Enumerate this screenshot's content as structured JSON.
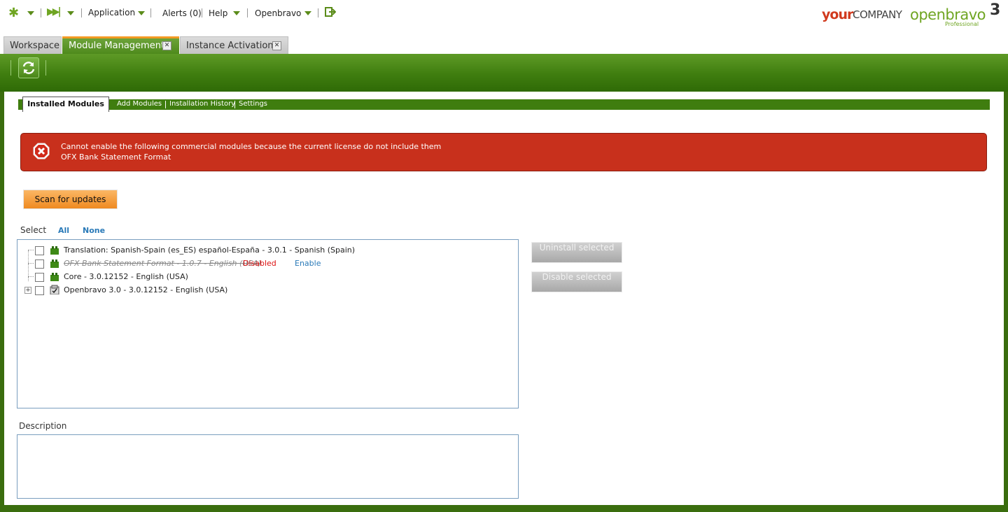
{
  "topnav": {
    "application": "Application",
    "alerts": "Alerts (0)",
    "help": "Help",
    "user": "Openbravo"
  },
  "brand": {
    "your": "your",
    "company": "COMPANY",
    "openbravo": "openbravo",
    "edition": "Professional",
    "version": "3"
  },
  "tabs": [
    {
      "label": "Workspace",
      "active": false
    },
    {
      "label": "Module Management",
      "active": true
    },
    {
      "label": "Instance Activation",
      "active": false
    }
  ],
  "subtabs": {
    "active": "Installed Modules",
    "links": [
      "Add Modules",
      "Installation History",
      "Settings"
    ]
  },
  "error": {
    "line1": "Cannot enable the following commercial modules because the current license do not include them",
    "line2": "OFX Bank Statement Format"
  },
  "scan_button": "Scan for updates",
  "select": {
    "label": "Select",
    "all": "All",
    "none": "None"
  },
  "modules": [
    {
      "text": "Translation: Spanish-Spain (es_ES) español-España - 3.0.1 - Spanish (Spain)",
      "expandable": false
    },
    {
      "text": "OFX Bank Statement Format - 1.0.7 - English (USA)",
      "status": "Disabled",
      "action": "Enable",
      "expandable": false
    },
    {
      "text": "Core - 3.0.12152 - English (USA)",
      "expandable": false
    },
    {
      "text": "Openbravo 3.0 - 3.0.12152 - English (USA)",
      "expandable": true
    }
  ],
  "side_buttons": {
    "uninstall": "Uninstall selected",
    "disable": "Disable selected"
  },
  "description_label": "Description",
  "colors": {
    "accent_green": "#4e8a1c",
    "error_red": "#c8301c",
    "scan_orange": "#f39a24",
    "link_blue": "#2a7ab8"
  }
}
